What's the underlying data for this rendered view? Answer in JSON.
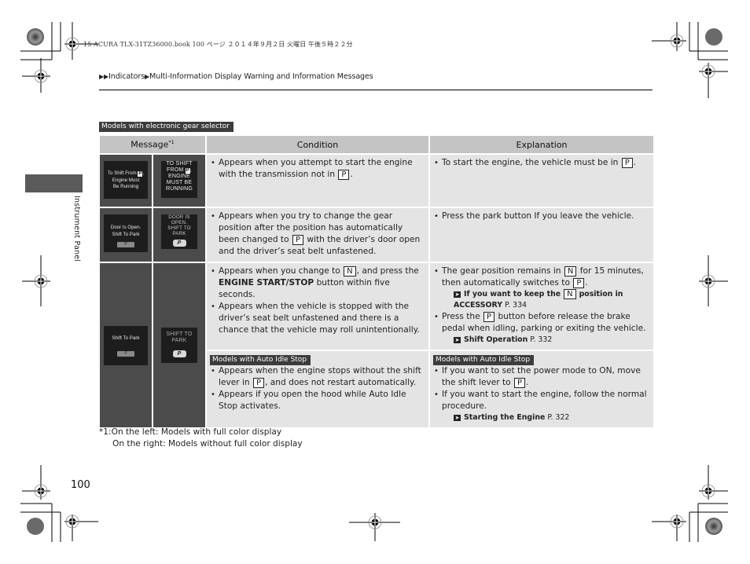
{
  "print_header": "15 ACURA TLX-31TZ36000.book  100 ページ  ２０１４年９月２日  火曜日  午後５時２２分",
  "breadcrumb": {
    "prefix_icon": "double-triangle-right",
    "items": [
      "Indicators",
      "Multi-Information Display Warning and Information Messages"
    ]
  },
  "side_section_label": "Instrument Panel",
  "top_badge": "Models with electronic gear selector",
  "table": {
    "headers": {
      "message": "Message",
      "message_note": "*1",
      "condition": "Condition",
      "explanation": "Explanation"
    },
    "rows": [
      {
        "display_color": {
          "line1": "To Shift From",
          "key": "P",
          "line2": "Engine Must",
          "line3": "Be Running"
        },
        "display_mono": {
          "line1": "TO SHIFT",
          "line2a": "FROM",
          "key": "P",
          "line3": "ENGINE",
          "line4": "MUST BE",
          "line5": "RUNNING"
        },
        "condition": [
          {
            "t1": "Appears when you attempt to start the engine with the transmission not in",
            "key": "P",
            "t2": "."
          }
        ],
        "explanation": [
          {
            "t1": "To start the engine, the vehicle must be in",
            "key": "P",
            "t2": "."
          }
        ]
      },
      {
        "display_color": {
          "line1": "Door Is Open.",
          "line2": "Shift To Park",
          "button": "P"
        },
        "display_mono": {
          "line1": "DOOR IS OPEN.",
          "line2": "SHIFT TO",
          "line3": "PARK",
          "button": "P"
        },
        "condition": [
          {
            "t1": "Appears when you try to change the gear position after the position has automatically been changed to",
            "key": "P",
            "t2": "with the driver’s door open and the driver’s seat belt unfastened."
          }
        ],
        "explanation": [
          {
            "t1": "Press the park button If you leave the vehicle."
          }
        ]
      },
      {
        "display_color": {
          "line1": "Shift To Park",
          "button": "P"
        },
        "display_mono": {
          "line1": "SHIFT TO",
          "line2": "PARK",
          "button": "P"
        },
        "condition": [
          {
            "t1": "Appears when you change to",
            "key": "N",
            "t2": ", and press the",
            "bold": "ENGINE START/STOP",
            "t3": "button within five seconds."
          },
          {
            "t1": "Appears when the vehicle is stopped with the driver’s seat belt unfastened and there is a chance that the vehicle may roll unintentionally."
          }
        ],
        "explanation": [
          {
            "t1": "The gear position remains in",
            "key": "N",
            "t2": "for 15 minutes, then automatically switches to",
            "key2": "P",
            "t3": ".",
            "ref": {
              "bold1": "If you want to keep the",
              "key": "N",
              "bold2": "position in ACCESSORY",
              "page": "P. 334"
            }
          },
          {
            "t1": "Press the",
            "key": "P",
            "t2": "button before release the brake pedal when idling, parking or exiting the vehicle.",
            "ref": {
              "bold1": "Shift Operation",
              "page": "P. 332"
            }
          }
        ],
        "sub": {
          "badge": "Models with Auto Idle Stop",
          "condition": [
            {
              "t1": "Appears when the engine stops without the shift lever in",
              "key": "P",
              "t2": ", and does not restart automatically."
            },
            {
              "t1": "Appears if you open the hood while Auto Idle Stop activates."
            }
          ],
          "explanation_badge": "Models with Auto Idle Stop",
          "explanation": [
            {
              "t1": "If you want to set the power mode to ON, move the shift lever to",
              "key": "P",
              "t2": "."
            },
            {
              "t1": "If you want to start the engine, follow the normal procedure.",
              "ref": {
                "bold1": "Starting the Engine",
                "page": "P. 322"
              }
            }
          ]
        }
      }
    ]
  },
  "footnote": {
    "line1": "*1:On the left: Models with full color display",
    "line2": "On the right: Models without full color display"
  },
  "page_number": "100",
  "colors": {
    "header_bg": "#c4c4c4",
    "cell_bg": "#e4e4e4",
    "image_cell_bg": "#4b4b4b",
    "badge_bg": "#3c3c3c",
    "side_tab": "#5a5a5a"
  }
}
